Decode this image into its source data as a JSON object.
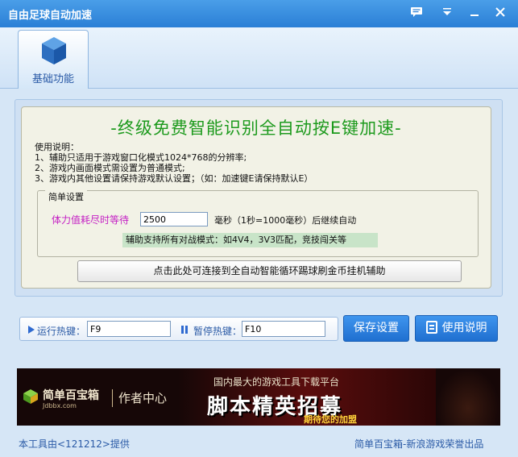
{
  "window": {
    "title": "自由足球自动加速",
    "controls": [
      "chat-icon",
      "dropdown-icon",
      "minimize-icon",
      "close-icon"
    ]
  },
  "tabs": [
    {
      "label": "基础功能",
      "icon": "cube-icon",
      "active": true
    }
  ],
  "main": {
    "headline": "-终级免费智能识别全自动按E键加速-",
    "usage": {
      "heading": "使用说明：",
      "lines": [
        "1、辅助只适用于游戏窗口化模式1024*768的分辨率;",
        "2、游戏内画面模式需设置为普通模式;",
        "3、游戏内其他设置请保持游戏默认设置；（如：加速键E请保持默认E）"
      ]
    },
    "settings": {
      "legend": "简单设置",
      "stamina_label": "体力值耗尽时等待",
      "stamina_value": "2500",
      "stamina_hint": "毫秒（1秒=1000毫秒）后继续自动",
      "modes_note": "辅助支持所有对战模式：如4V4，3V3匹配，竞技闯关等"
    },
    "connect_button": "点击此处可连接到全自动智能循环踢球刷金币挂机辅助"
  },
  "hotkeys": {
    "run_label": "运行热键：",
    "run_value": "F9",
    "pause_label": "暂停热键：",
    "pause_value": "F10"
  },
  "buttons": {
    "save": "保存设置",
    "help": "使用说明"
  },
  "banner": {
    "brand": "简单百宝箱",
    "url": "Jdbbx.com",
    "author_center": "作者中心",
    "subtitle": "国内最大的游戏工具下载平台",
    "main": "脚本精英招募",
    "tagline": "期待您的加盟"
  },
  "footer": {
    "left": "本工具由<121212>提供",
    "right": "简单百宝箱-新浪游戏荣誉出品"
  },
  "colors": {
    "accent": "#2a7fd6",
    "headline": "#1d9a1d",
    "stamina_label": "#c41fc4"
  }
}
